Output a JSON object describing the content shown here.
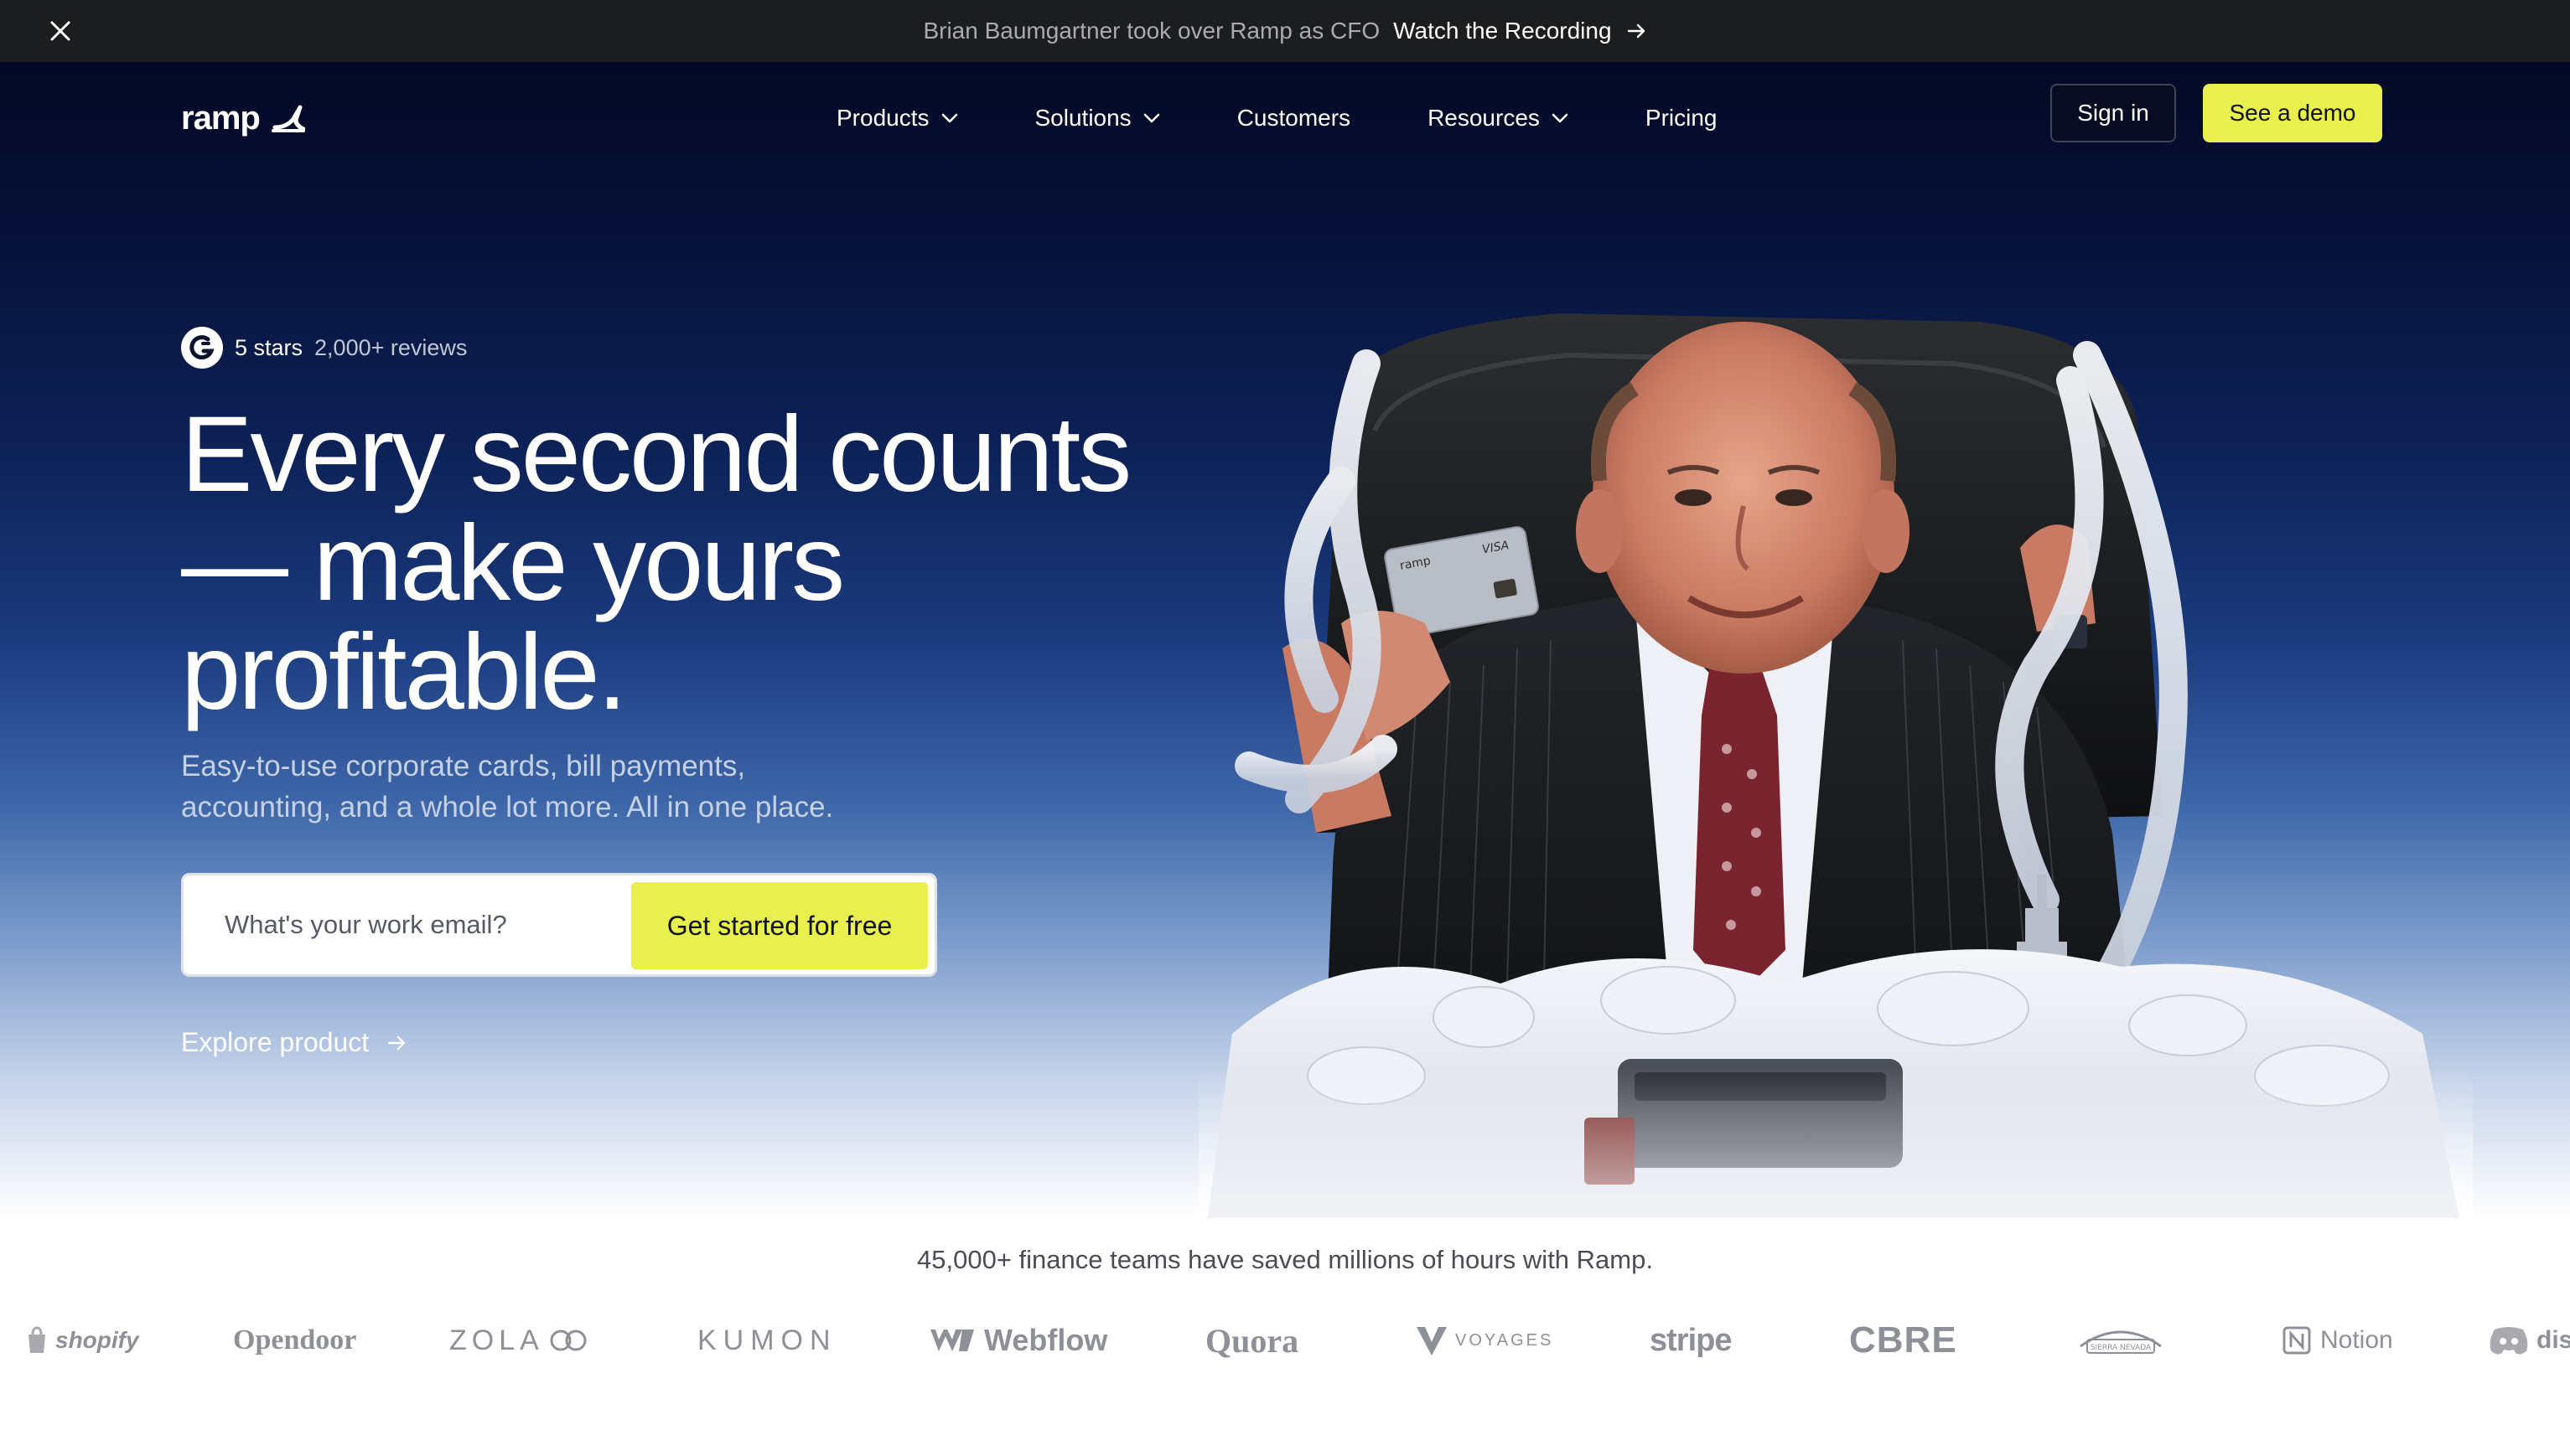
{
  "announcement": {
    "message": "Brian Baumgartner took over Ramp as CFO",
    "link_label": "Watch the Recording"
  },
  "nav": {
    "brand": "ramp",
    "menu": [
      {
        "label": "Products",
        "has_dropdown": true
      },
      {
        "label": "Solutions",
        "has_dropdown": true
      },
      {
        "label": "Customers",
        "has_dropdown": false
      },
      {
        "label": "Resources",
        "has_dropdown": true
      },
      {
        "label": "Pricing",
        "has_dropdown": false
      }
    ],
    "signin_label": "Sign in",
    "demo_label": "See a demo"
  },
  "hero": {
    "rating_stars": "5 stars",
    "rating_reviews": "2,000+ reviews",
    "headline_line1": "Every second counts",
    "headline_line2": "— make yours",
    "headline_line3": "profitable.",
    "subtext_line1": "Easy-to-use corporate cards, bill payments,",
    "subtext_line2": "accounting, and a whole lot more. All in one place.",
    "email_placeholder": "What's your work email?",
    "cta_label": "Get started for free",
    "explore_label": "Explore product",
    "card_brand": "ramp",
    "card_network": "VISA"
  },
  "social_proof": {
    "caption": "45,000+ finance teams have saved millions of hours with Ramp.",
    "logos": [
      "shopify",
      "Opendoor",
      "ZOLA",
      "KUMON",
      "Webflow",
      "Quora",
      "VOYAGES",
      "stripe",
      "CBRE",
      "SIERRA NEVADA",
      "Notion",
      "discord"
    ]
  },
  "colors": {
    "accent": "#e7f04c",
    "announcement_bg": "#1c1d1f",
    "hero_top": "#030824",
    "hero_mid": "#1b3b7e"
  }
}
